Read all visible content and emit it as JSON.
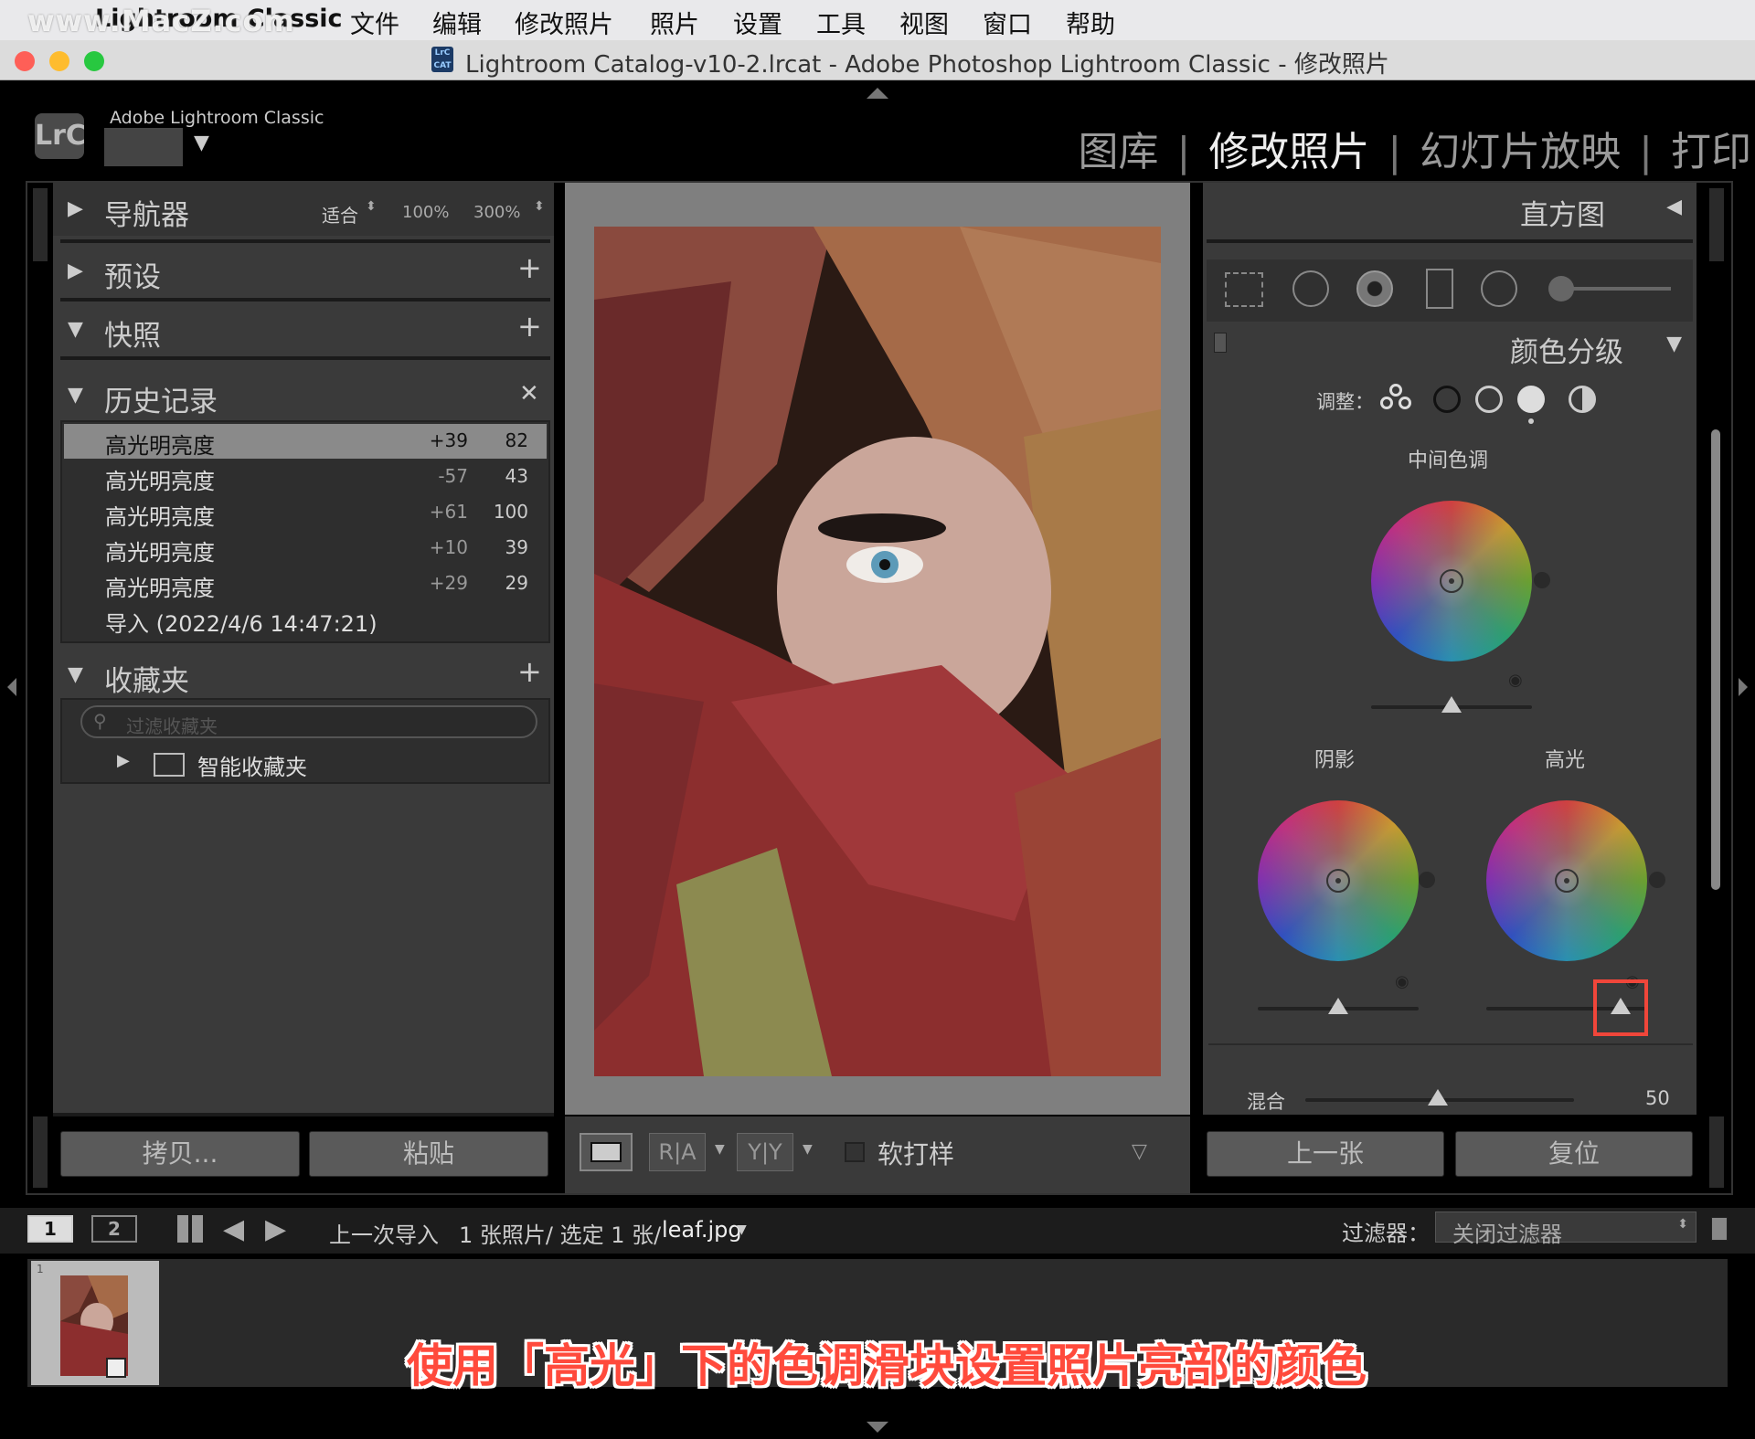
{
  "menubar": {
    "watermark": "www.MacZ.com",
    "app_name": "Lightroom Classic",
    "items": [
      "文件",
      "编辑",
      "修改照片",
      "照片",
      "设置",
      "工具",
      "视图",
      "窗口",
      "帮助"
    ]
  },
  "window": {
    "title": "Lightroom Catalog-v10-2.lrcat - Adobe Photoshop Lightroom Classic - 修改照片",
    "doc_icon_label": "LrC CAT"
  },
  "identity": {
    "logo": "LrC",
    "product_name": "Adobe Lightroom Classic"
  },
  "modules": {
    "items": [
      "图库",
      "修改照片",
      "幻灯片放映",
      "打印"
    ],
    "active": "修改照片"
  },
  "left_panel": {
    "navigator": {
      "title": "导航器",
      "zoom_fit": "适合",
      "zoom_100": "100%",
      "zoom_300": "300%"
    },
    "presets": {
      "title": "预设"
    },
    "snapshots": {
      "title": "快照"
    },
    "history": {
      "title": "历史记录",
      "rows": [
        {
          "label": "高光明亮度",
          "delta": "+39",
          "value": "82"
        },
        {
          "label": "高光明亮度",
          "delta": "-57",
          "value": "43"
        },
        {
          "label": "高光明亮度",
          "delta": "+61",
          "value": "100"
        },
        {
          "label": "高光明亮度",
          "delta": "+10",
          "value": "39"
        },
        {
          "label": "高光明亮度",
          "delta": "+29",
          "value": "29"
        },
        {
          "label": "导入 (2022/4/6 14:47:21)",
          "delta": "",
          "value": ""
        }
      ]
    },
    "collections": {
      "title": "收藏夹",
      "filter_placeholder": "过滤收藏夹",
      "smart_collections": "智能收藏夹"
    },
    "copy_button": "拷贝...",
    "paste_button": "粘贴"
  },
  "center_toolbar": {
    "soft_proofing": "软打样"
  },
  "right_panel": {
    "histogram_title": "直方图",
    "color_grading_title": "颜色分级",
    "adjust_label": "调整：",
    "midtones_label": "中间色调",
    "shadows_label": "阴影",
    "highlights_label": "高光",
    "blending_label": "混合",
    "blending_value": "50",
    "prev_button": "上一张",
    "reset_button": "复位"
  },
  "filmstrip_bar": {
    "view1": "1",
    "view2": "2",
    "source": "上一次导入",
    "count": "1 张照片/ 选定 1 张/",
    "filename": "leaf.jpg",
    "filter_label": "过滤器：",
    "filter_value": "关闭过滤器"
  },
  "filmstrip": {
    "thumb_index": "1"
  },
  "caption": "使用「高光」下的色调滑块设置照片亮部的颜色"
}
